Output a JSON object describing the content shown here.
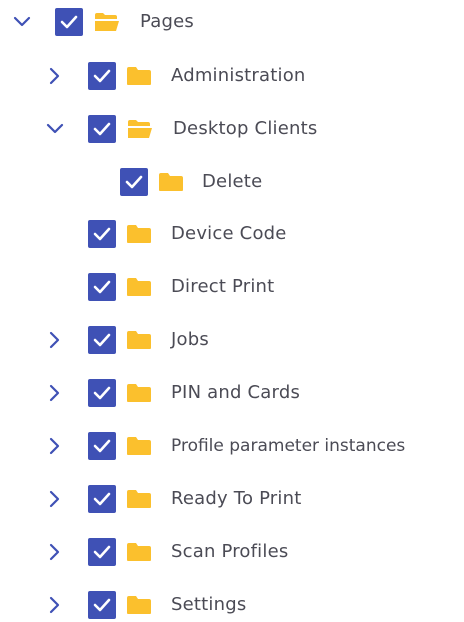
{
  "tree": {
    "root": {
      "label": "Pages",
      "expanded": true,
      "checked": true
    },
    "items": [
      {
        "label": "Administration",
        "expanded": false,
        "has_children": true,
        "checked": true
      },
      {
        "label": "Desktop Clients",
        "expanded": true,
        "has_children": true,
        "checked": true
      },
      {
        "label": "Delete",
        "expanded": false,
        "has_children": false,
        "checked": true
      },
      {
        "label": "Device Code",
        "expanded": false,
        "has_children": false,
        "checked": true
      },
      {
        "label": "Direct Print",
        "expanded": false,
        "has_children": false,
        "checked": true
      },
      {
        "label": "Jobs",
        "expanded": false,
        "has_children": true,
        "checked": true
      },
      {
        "label": "PIN and Cards",
        "expanded": false,
        "has_children": true,
        "checked": true
      },
      {
        "label": "Profile parameter instances",
        "expanded": false,
        "has_children": true,
        "checked": true
      },
      {
        "label": "Ready To Print",
        "expanded": false,
        "has_children": true,
        "checked": true
      },
      {
        "label": "Scan Profiles",
        "expanded": false,
        "has_children": true,
        "checked": true
      },
      {
        "label": "Settings",
        "expanded": false,
        "has_children": true,
        "checked": true
      }
    ]
  },
  "colors": {
    "checkbox": "#3f51b5",
    "chevron": "#3f51b5",
    "folder": "#fbc02d",
    "text": "#4b4b55"
  },
  "icons": {
    "expanded": "chevron-down-icon",
    "collapsed": "chevron-right-icon",
    "folder_open": "folder-open-icon",
    "folder_closed": "folder-icon",
    "check": "check-icon"
  }
}
